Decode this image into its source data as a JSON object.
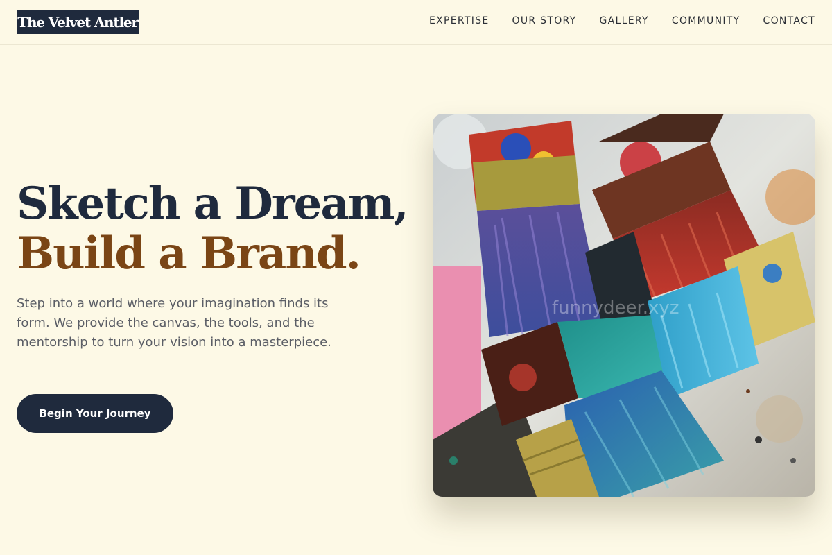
{
  "brand": {
    "name": "The Velvet Antler"
  },
  "nav": {
    "items": [
      {
        "label": "EXPERTISE"
      },
      {
        "label": "OUR STORY"
      },
      {
        "label": "GALLERY"
      },
      {
        "label": "COMMUNITY"
      },
      {
        "label": "CONTACT"
      }
    ]
  },
  "hero": {
    "headline_line1": "Sketch a Dream,",
    "headline_line2": "Build a Brand.",
    "intro": "Step into a world where your imagination finds its form. We provide the canvas, the tools, and the mentorship to turn your vision into a masterpiece.",
    "cta_label": "Begin Your Journey",
    "image_watermark": "funnydeer.xyz"
  },
  "colors": {
    "background": "#fdf9e6",
    "navy": "#1f2a3d",
    "accent_brown": "#7a4515",
    "body_text": "#5b5e66"
  }
}
